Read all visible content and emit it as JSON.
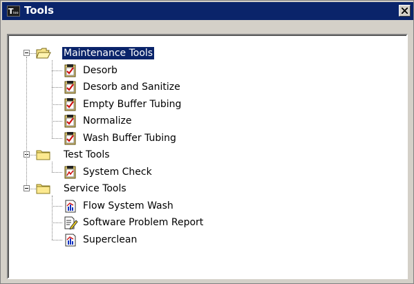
{
  "window": {
    "title": "Tools",
    "app_icon_name": "app-logo-icon",
    "close_icon_name": "close-icon",
    "title_bar_color": "#0a246a"
  },
  "tree": {
    "groups": [
      {
        "label": "Maintenance Tools",
        "expanded": true,
        "selected": true,
        "icon": "open-folder-icon",
        "items": [
          {
            "label": "Desorb",
            "icon": "clipboard-check-icon"
          },
          {
            "label": "Desorb and Sanitize",
            "icon": "clipboard-check-icon"
          },
          {
            "label": "Empty Buffer Tubing",
            "icon": "clipboard-check-icon"
          },
          {
            "label": "Normalize",
            "icon": "clipboard-check-icon"
          },
          {
            "label": "Wash Buffer Tubing",
            "icon": "clipboard-check-icon"
          }
        ]
      },
      {
        "label": "Test Tools",
        "expanded": true,
        "selected": false,
        "icon": "folder-icon",
        "items": [
          {
            "label": "System Check",
            "icon": "clipboard-chart-icon"
          }
        ]
      },
      {
        "label": "Service Tools",
        "expanded": true,
        "selected": false,
        "icon": "folder-icon",
        "items": [
          {
            "label": "Flow System Wash",
            "icon": "chart-doc-icon"
          },
          {
            "label": "Software Problem Report",
            "icon": "edit-doc-icon"
          },
          {
            "label": "Superclean",
            "icon": "chart-doc-icon"
          }
        ]
      }
    ]
  }
}
